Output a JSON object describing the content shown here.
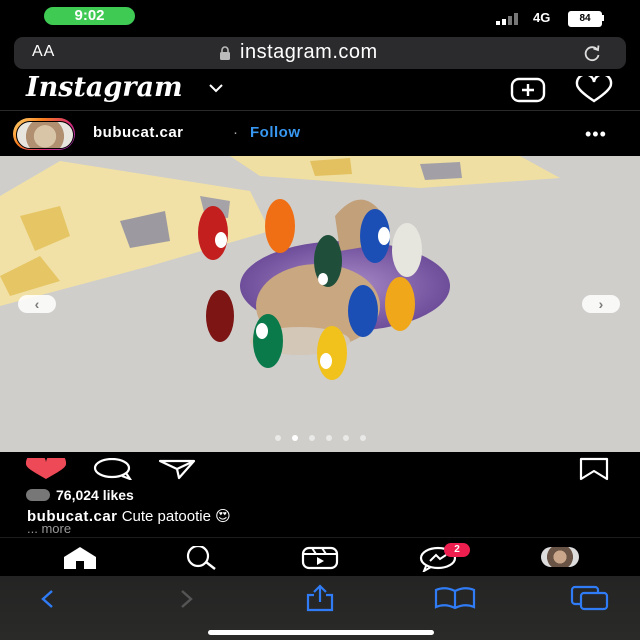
{
  "status_bar": {
    "time": "9:02",
    "network": "4G",
    "battery": "84"
  },
  "browser": {
    "text_size_label": "AA",
    "url": "instagram.com"
  },
  "header": {
    "logo_text": "Instagram"
  },
  "post": {
    "username": "bubucat.car",
    "separator": "·",
    "follow_label": "Follow",
    "more_label": "•••",
    "carousel_prev": "‹",
    "carousel_next": "›",
    "carousel_dots_total": 6,
    "carousel_active_index": 1,
    "likes_text": "76,024 likes",
    "caption_username": "bubucat.car",
    "caption_text": "Cute patootie",
    "caption_emoji": "😍",
    "caption_more": "... more"
  },
  "bottom_nav": {
    "messages_badge": "2",
    "items": [
      "home-icon",
      "search-icon",
      "reels-icon",
      "messenger-icon",
      "profile-avatar"
    ]
  },
  "safari_toolbar": {
    "items": [
      "back-icon",
      "forward-icon",
      "share-icon",
      "bookmarks-icon",
      "tabs-icon"
    ]
  },
  "colors": {
    "accent": "#3897f0",
    "like": "#ed4956",
    "badge": "#ee1f4f",
    "safari_blue": "#2f7cf6",
    "status_pill": "#3fca54"
  }
}
